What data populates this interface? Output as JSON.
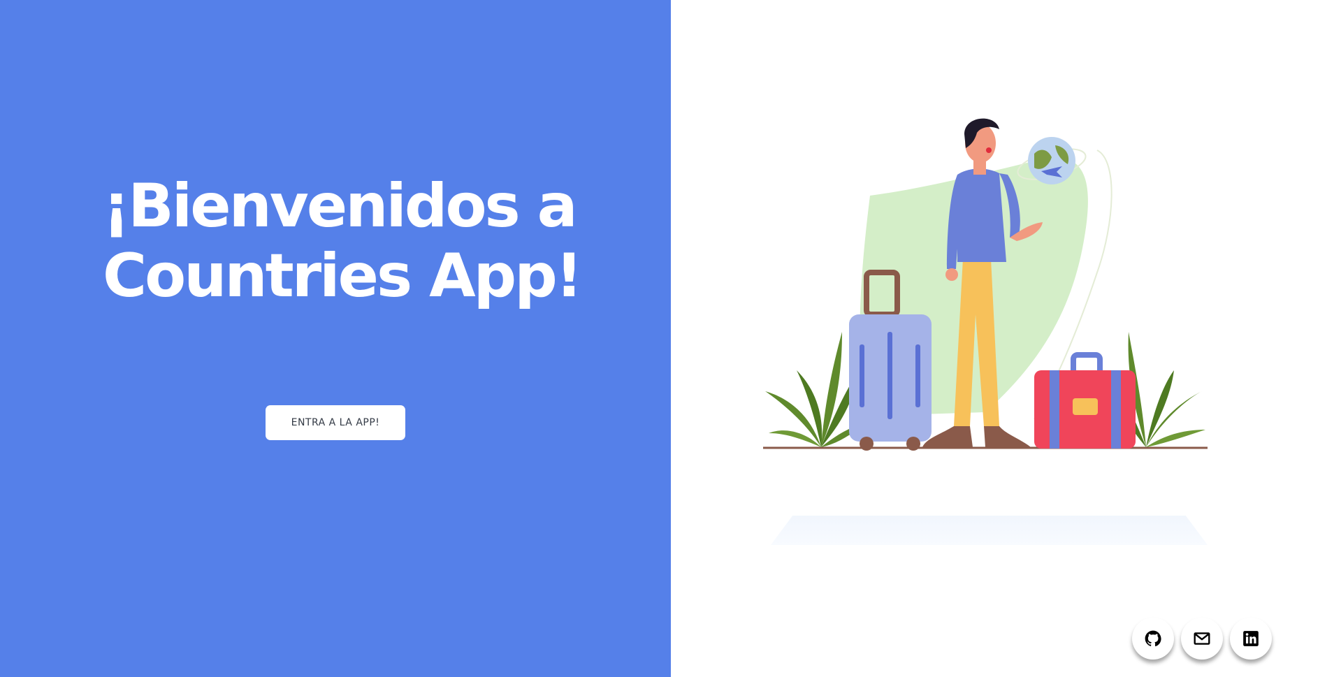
{
  "hero": {
    "title_line1": "¡Bienvenidos a",
    "title_line2": "Countries App!",
    "enter_label": "ENTRA A LA APP!"
  },
  "social": {
    "items": [
      {
        "icon": "github-icon"
      },
      {
        "icon": "mail-icon"
      },
      {
        "icon": "linkedin-icon"
      }
    ]
  },
  "colors": {
    "accent_blue": "#5580e9",
    "background": "#ffffff",
    "button_text": "#333a45"
  },
  "illustration": {
    "subject": "traveler-with-globe-illustration"
  }
}
